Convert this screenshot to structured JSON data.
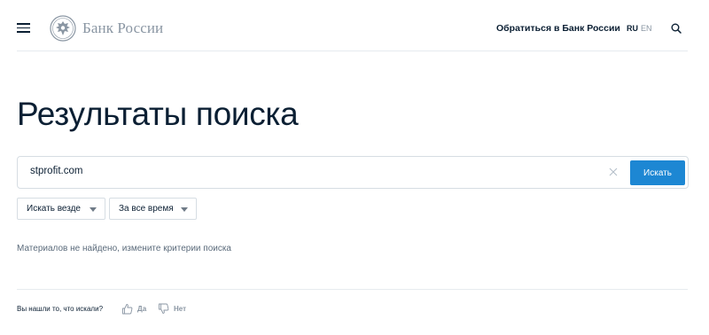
{
  "header": {
    "brand": "Банк России",
    "contact_link": "Обратиться в Банк России",
    "lang_ru": "RU",
    "lang_en": "EN"
  },
  "page_title": "Результаты поиска",
  "search": {
    "value": "stprofit.com",
    "button_label": "Искать"
  },
  "filters": {
    "scope": "Искать везде",
    "period": "За все время"
  },
  "results_message": "Материалов не найдено, измените критерии поиска",
  "feedback": {
    "question": "Вы нашли то, что искали?",
    "yes": "Да",
    "no": "Нет"
  },
  "colors": {
    "primary_button": "#1d87d3",
    "text": "#0b1f33",
    "muted": "#8a96a3"
  }
}
